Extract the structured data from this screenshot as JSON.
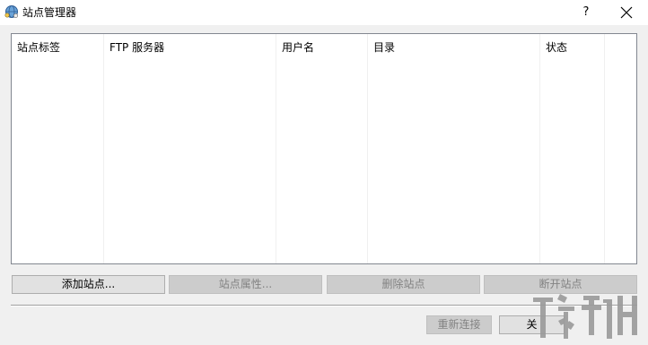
{
  "window": {
    "title": "站点管理器",
    "help_label": "?"
  },
  "icons": {
    "app": "network-globe-icon",
    "close": "close-icon"
  },
  "listview": {
    "columns": [
      {
        "label": "站点标签"
      },
      {
        "label": "FTP 服务器"
      },
      {
        "label": "用户名"
      },
      {
        "label": "目录"
      },
      {
        "label": "状态"
      }
    ],
    "rows": []
  },
  "actions": {
    "add_site": "添加站点...",
    "site_properties": "站点属性...",
    "delete_site": "删除站点",
    "disconnect_site": "断开站点"
  },
  "footer": {
    "reconnect": "重新连接",
    "close": "关"
  },
  "colors": {
    "window_bg": "#f0f0f0",
    "titlebar_bg": "#ffffff",
    "disabled_text": "#838383",
    "watermark": "#9a9a9a"
  }
}
